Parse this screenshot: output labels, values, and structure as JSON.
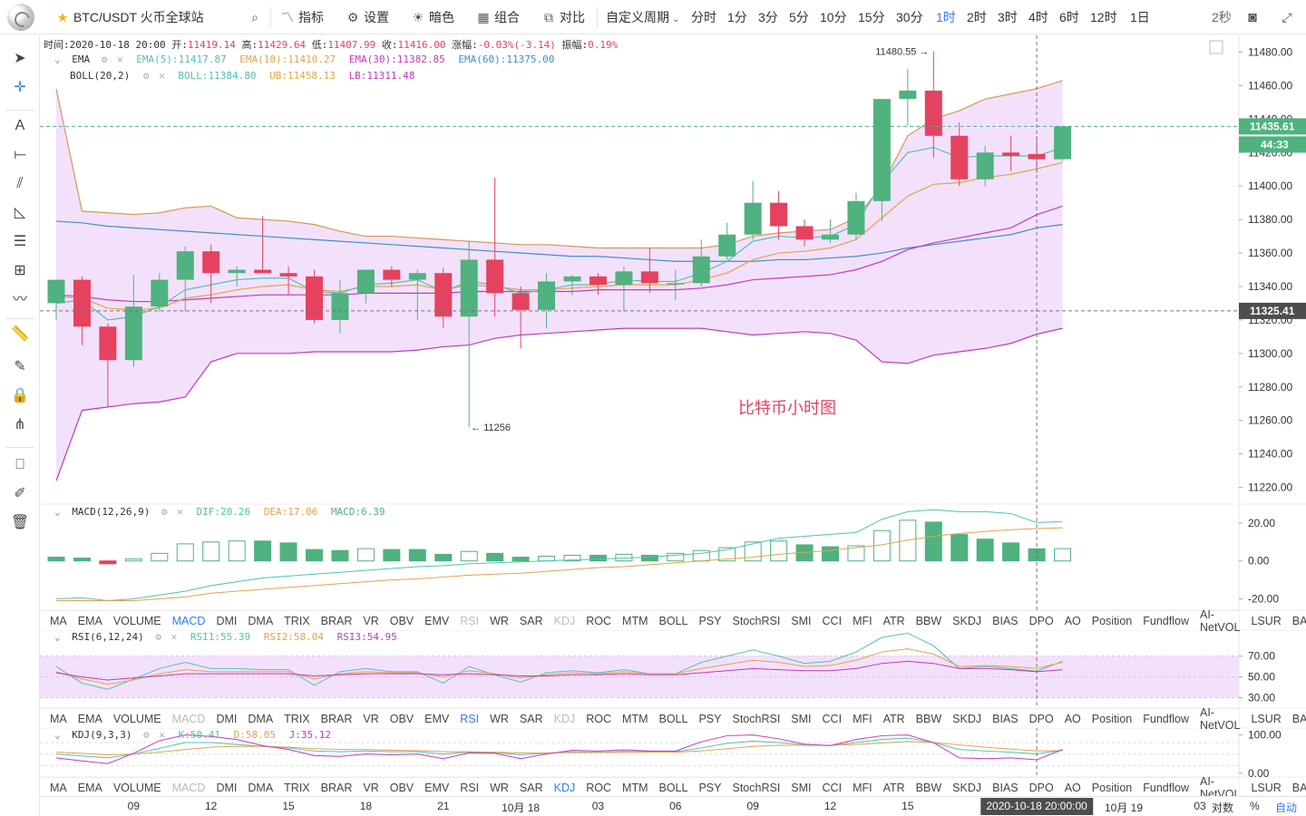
{
  "toolbar": {
    "symbol": "BTC/USDT 火币全球站",
    "indicators": "指标",
    "settings": "设置",
    "dark": "暗色",
    "combo": "组合",
    "compare": "对比",
    "custom_period": "自定义周期",
    "periods": [
      "分时",
      "1分",
      "3分",
      "5分",
      "10分",
      "15分",
      "30分",
      "1时",
      "2时",
      "3时",
      "4时",
      "6时",
      "12时",
      "1日"
    ],
    "active_period": "1时",
    "refresh": "2秒"
  },
  "ohlc_info": {
    "time_label": "时间:",
    "time": "2020-10-18 20:00",
    "open_label": "开:",
    "open": "11419.14",
    "high_label": "高:",
    "high": "11429.64",
    "low_label": "低:",
    "low": "11407.99",
    "close_label": "收:",
    "close": "11416.00",
    "change_label": "涨幅:",
    "change": "-0.03%(-3.14)",
    "amp_label": "振幅:",
    "amp": "0.19%"
  },
  "ema_legend": {
    "name": "EMA",
    "ema5": "EMA(5):11417.87",
    "ema10": "EMA(10):11410.27",
    "ema30": "EMA(30):11382.85",
    "ema60": "EMA(60):11375.00"
  },
  "boll_legend": {
    "name": "BOLL(20,2)",
    "boll": "BOLL:11384.80",
    "ub": "UB:11458.13",
    "lb": "LB:11311.48"
  },
  "macd_legend": {
    "name": "MACD(12,26,9)",
    "dif": "DIF:20.26",
    "dea": "DEA:17.06",
    "macd": "MACD:6.39"
  },
  "rsi_legend": {
    "name": "RSI(6,12,24)",
    "rsi1": "RSI1:55.39",
    "rsi2": "RSI2:58.04",
    "rsi3": "RSI3:54.95"
  },
  "kdj_legend": {
    "name": "KDJ(9,3,3)",
    "k": "K:50.41",
    "d": "D:58.05",
    "j": "J:35.12"
  },
  "indicator_tabs": [
    "MA",
    "EMA",
    "VOLUME",
    "MACD",
    "DMI",
    "DMA",
    "TRIX",
    "BRAR",
    "VR",
    "OBV",
    "EMV",
    "RSI",
    "WR",
    "SAR",
    "KDJ",
    "ROC",
    "MTM",
    "BOLL",
    "PSY",
    "StochRSI",
    "SMI",
    "CCI",
    "MFI",
    "ATR",
    "BBW",
    "SKDJ",
    "BIAS",
    "DPO",
    "AO",
    "Position",
    "Fundflow",
    "AI-NetVOL",
    "LSUR",
    "BASIS"
  ],
  "tab_rows": [
    {
      "on": "MACD",
      "dim": [
        "RSI",
        "KDJ"
      ]
    },
    {
      "on": "RSI",
      "dim": [
        "MACD",
        "KDJ"
      ]
    },
    {
      "on": "KDJ",
      "dim": [
        "MACD"
      ]
    }
  ],
  "chart_annotation": "比特币小时图",
  "price_labels": {
    "current": "11435.61",
    "countdown": "44:33",
    "cursor": "11325.41",
    "high_mark": "11480.55 →",
    "low_mark": "← 11256"
  },
  "x_axis": {
    "ticks": [
      {
        "label": "09",
        "i": 3
      },
      {
        "label": "12",
        "i": 6
      },
      {
        "label": "15",
        "i": 9
      },
      {
        "label": "18",
        "i": 12
      },
      {
        "label": "21",
        "i": 15
      },
      {
        "label": "10月 18",
        "i": 18
      },
      {
        "label": "03",
        "i": 21
      },
      {
        "label": "06",
        "i": 24
      },
      {
        "label": "09",
        "i": 27
      },
      {
        "label": "12",
        "i": 30
      },
      {
        "label": "15",
        "i": 33
      }
    ],
    "cursor_label": "2020-10-18 20:00:00",
    "next_label": "10月 19",
    "tail_label": "03",
    "log_label": "对数",
    "percent_label": "%",
    "auto_label": "自动"
  },
  "colors": {
    "up": "#4fb27f",
    "down": "#e5425f",
    "accent": "#2f7df6",
    "ema5": "#4fc1b5",
    "ema10": "#e0a44a",
    "ema30": "#c339c0",
    "ema60": "#3c90c9",
    "boll_ub": "#d29a55",
    "boll_lb": "#c339c0"
  },
  "chart_data": {
    "type": "candlestick",
    "price_axis": {
      "min": 11210,
      "max": 11490,
      "ticks": [
        11220,
        11240,
        11260,
        11280,
        11300,
        11320,
        11340,
        11360,
        11380,
        11400,
        11420,
        11440,
        11460,
        11480
      ]
    },
    "candles": [
      {
        "o": 11330,
        "h": 11342,
        "l": 11320,
        "c": 11344
      },
      {
        "o": 11344,
        "h": 11346,
        "l": 11305,
        "c": 11316
      },
      {
        "o": 11316,
        "h": 11318,
        "l": 11268,
        "c": 11296
      },
      {
        "o": 11296,
        "h": 11347,
        "l": 11292,
        "c": 11328
      },
      {
        "o": 11328,
        "h": 11348,
        "l": 11325,
        "c": 11344
      },
      {
        "o": 11344,
        "h": 11364,
        "l": 11325,
        "c": 11361
      },
      {
        "o": 11361,
        "h": 11365,
        "l": 11330,
        "c": 11348
      },
      {
        "o": 11348,
        "h": 11352,
        "l": 11340,
        "c": 11350
      },
      {
        "o": 11350,
        "h": 11382,
        "l": 11348,
        "c": 11348
      },
      {
        "o": 11348,
        "h": 11352,
        "l": 11335,
        "c": 11346
      },
      {
        "o": 11346,
        "h": 11350,
        "l": 11318,
        "c": 11320
      },
      {
        "o": 11320,
        "h": 11344,
        "l": 11312,
        "c": 11336
      },
      {
        "o": 11336,
        "h": 11350,
        "l": 11330,
        "c": 11350
      },
      {
        "o": 11350,
        "h": 11352,
        "l": 11340,
        "c": 11344
      },
      {
        "o": 11344,
        "h": 11350,
        "l": 11320,
        "c": 11348
      },
      {
        "o": 11348,
        "h": 11351,
        "l": 11315,
        "c": 11322
      },
      {
        "o": 11322,
        "h": 11367,
        "l": 11256,
        "c": 11356
      },
      {
        "o": 11356,
        "h": 11405,
        "l": 11322,
        "c": 11336
      },
      {
        "o": 11336,
        "h": 11340,
        "l": 11303,
        "c": 11326
      },
      {
        "o": 11326,
        "h": 11348,
        "l": 11315,
        "c": 11343
      },
      {
        "o": 11343,
        "h": 11347,
        "l": 11335,
        "c": 11346
      },
      {
        "o": 11346,
        "h": 11348,
        "l": 11335,
        "c": 11341
      },
      {
        "o": 11341,
        "h": 11352,
        "l": 11325,
        "c": 11349
      },
      {
        "o": 11349,
        "h": 11363,
        "l": 11336,
        "c": 11342
      },
      {
        "o": 11342,
        "h": 11350,
        "l": 11332,
        "c": 11342
      },
      {
        "o": 11342,
        "h": 11368,
        "l": 11340,
        "c": 11358
      },
      {
        "o": 11358,
        "h": 11378,
        "l": 11356,
        "c": 11371
      },
      {
        "o": 11371,
        "h": 11403,
        "l": 11368,
        "c": 11390
      },
      {
        "o": 11390,
        "h": 11397,
        "l": 11368,
        "c": 11376
      },
      {
        "o": 11376,
        "h": 11380,
        "l": 11364,
        "c": 11368
      },
      {
        "o": 11368,
        "h": 11380,
        "l": 11366,
        "c": 11371
      },
      {
        "o": 11371,
        "h": 11396,
        "l": 11368,
        "c": 11391
      },
      {
        "o": 11391,
        "h": 11401,
        "l": 11379,
        "c": 11452
      },
      {
        "o": 11452,
        "h": 11470,
        "l": 11436,
        "c": 11457
      },
      {
        "o": 11457,
        "h": 11480.55,
        "l": 11417,
        "c": 11430
      },
      {
        "o": 11430,
        "h": 11438,
        "l": 11400,
        "c": 11404
      },
      {
        "o": 11404,
        "h": 11424,
        "l": 11400,
        "c": 11420
      },
      {
        "o": 11420,
        "h": 11430,
        "l": 11409,
        "c": 11418
      },
      {
        "o": 11419.14,
        "h": 11429.64,
        "l": 11407.99,
        "c": 11416.0
      },
      {
        "o": 11416,
        "h": 11436,
        "l": 11415,
        "c": 11435.61
      }
    ],
    "ema5": [
      11330,
      11332,
      11320,
      11322,
      11328,
      11338,
      11341,
      11344,
      11345,
      11345,
      11337,
      11336,
      11341,
      11342,
      11344,
      11337,
      11343,
      11341,
      11336,
      11338,
      11341,
      11341,
      11344,
      11343,
      11343,
      11348,
      11355,
      11367,
      11370,
      11369,
      11370,
      11377,
      11402,
      11420,
      11423,
      11417,
      11418,
      11418,
      11417.87,
      11423
    ],
    "ema10": [
      11334,
      11333,
      11327,
      11326,
      11327,
      11333,
      11335,
      11338,
      11340,
      11341,
      11338,
      11337,
      11340,
      11340,
      11341,
      11338,
      11341,
      11340,
      11338,
      11338,
      11339,
      11340,
      11341,
      11341,
      11341,
      11344,
      11348,
      11356,
      11360,
      11361,
      11363,
      11368,
      11381,
      11394,
      11401,
      11402,
      11405,
      11407,
      11410.27,
      11414
    ],
    "ema30": [
      11335,
      11334,
      11332,
      11331,
      11331,
      11332,
      11333,
      11334,
      11335,
      11335,
      11335,
      11335,
      11336,
      11336,
      11336,
      11336,
      11337,
      11337,
      11337,
      11337,
      11337,
      11338,
      11338,
      11338,
      11338,
      11339,
      11341,
      11344,
      11345,
      11346,
      11347,
      11350,
      11355,
      11362,
      11366,
      11369,
      11372,
      11375,
      11382.85,
      11388
    ],
    "ema60": [
      11379,
      11378,
      11376,
      11375,
      11374,
      11373,
      11372,
      11371,
      11370,
      11369,
      11368,
      11367,
      11366,
      11365,
      11364,
      11363,
      11362,
      11361,
      11360,
      11359,
      11358,
      11358,
      11357,
      11356,
      11355,
      11355,
      11355,
      11355,
      11356,
      11356,
      11357,
      11358,
      11360,
      11363,
      11365,
      11367,
      11369,
      11371,
      11375.0,
      11377
    ],
    "boll_ub": [
      11458,
      11385,
      11384,
      11383,
      11384,
      11387,
      11388,
      11381,
      11380,
      11379,
      11377,
      11373,
      11370,
      11370,
      11369,
      11368,
      11367,
      11366,
      11365,
      11365,
      11364,
      11363,
      11363,
      11363,
      11363,
      11363,
      11365,
      11370,
      11372,
      11373,
      11374,
      11381,
      11400,
      11430,
      11440,
      11445,
      11452,
      11455,
      11458.13,
      11463
    ],
    "boll_mid": [
      11348,
      11346,
      11338,
      11336,
      11337,
      11340,
      11342,
      11340,
      11341,
      11341,
      11340,
      11340,
      11340,
      11340,
      11340,
      11339,
      11339,
      11339,
      11339,
      11339,
      11339,
      11340,
      11340,
      11340,
      11340,
      11340,
      11342,
      11346,
      11348,
      11350,
      11351,
      11354,
      11360,
      11370,
      11377,
      11379,
      11381,
      11383,
      11384.8,
      11387
    ],
    "boll_lb": [
      11224,
      11266,
      11268,
      11270,
      11271,
      11274,
      11295,
      11300,
      11300,
      11300,
      11301,
      11301,
      11301,
      11301,
      11302,
      11304,
      11305,
      11309,
      11311,
      11312,
      11313,
      11314,
      11315,
      11315,
      11315,
      11315,
      11313,
      11311,
      11312,
      11313,
      11312,
      11308,
      11295,
      11294,
      11299,
      11301,
      11303,
      11306,
      11311.48,
      11315
    ],
    "macd_axis": {
      "ticks": [
        20,
        0,
        -20
      ]
    },
    "macd_hist": [
      2,
      1.5,
      -1.5,
      1,
      4,
      9,
      10,
      10.5,
      10.5,
      9.5,
      6,
      5.5,
      6.5,
      6,
      6,
      3.5,
      5,
      4,
      2,
      2.5,
      3,
      3,
      3.5,
      3,
      4,
      5.5,
      7,
      10,
      10.5,
      8.5,
      7.5,
      8,
      16,
      21.5,
      20.5,
      14,
      11.5,
      9.5,
      6.39,
      6.5
    ],
    "macd_dif": [
      -20,
      -19.5,
      -21,
      -20,
      -18,
      -16,
      -13,
      -11,
      -9,
      -8,
      -7,
      -6,
      -5,
      -4,
      -3,
      -2.5,
      -1.5,
      -1,
      -0.5,
      0,
      0.5,
      1,
      1.5,
      2,
      3,
      4,
      6,
      9,
      12,
      13,
      14,
      15,
      22,
      26,
      27,
      26,
      26,
      25,
      20.26,
      20.8
    ],
    "macd_dea": [
      -21,
      -21,
      -21,
      -21,
      -20,
      -19,
      -17,
      -16,
      -15,
      -14,
      -13,
      -12,
      -11,
      -10,
      -9.5,
      -8.5,
      -7.5,
      -7,
      -6.5,
      -5.5,
      -4.5,
      -3.5,
      -3,
      -2,
      -1,
      0,
      1,
      2,
      3.5,
      4.5,
      5.5,
      7,
      8.5,
      11,
      13,
      14.5,
      15.5,
      16.5,
      17.06,
      17.5
    ],
    "rsi_axis": {
      "ticks": [
        70,
        50,
        30
      ]
    },
    "rsi1": [
      60,
      44,
      38,
      48,
      58,
      64,
      58,
      58,
      57,
      57,
      42,
      55,
      58,
      55,
      55,
      44,
      60,
      52,
      45,
      54,
      56,
      54,
      57,
      53,
      53,
      64,
      70,
      76,
      70,
      63,
      65,
      74,
      88,
      92,
      80,
      58,
      60,
      58,
      55.39,
      65
    ],
    "rsi2": [
      55,
      48,
      43,
      47,
      53,
      57,
      55,
      55,
      55,
      55,
      48,
      53,
      55,
      54,
      54,
      50,
      56,
      53,
      49,
      52,
      54,
      53,
      55,
      53,
      53,
      58,
      62,
      66,
      64,
      60,
      61,
      66,
      74,
      77,
      72,
      60,
      61,
      60,
      58.04,
      64
    ],
    "rsi3": [
      54,
      50,
      47,
      49,
      51,
      53,
      53,
      53,
      53,
      53,
      51,
      52,
      53,
      53,
      53,
      52,
      53,
      52,
      51,
      51,
      52,
      52,
      53,
      52,
      52,
      54,
      56,
      58,
      57,
      56,
      56,
      58,
      63,
      65,
      63,
      58,
      58,
      57,
      54.95,
      57
    ],
    "kdj_axis": {
      "ticks": [
        100,
        0
      ]
    },
    "kdj_k": [
      50,
      45,
      40,
      50,
      65,
      80,
      80,
      75,
      70,
      66,
      58,
      56,
      58,
      56,
      56,
      50,
      55,
      54,
      48,
      52,
      56,
      55,
      57,
      56,
      56,
      66,
      78,
      84,
      80,
      74,
      72,
      80,
      88,
      92,
      80,
      62,
      58,
      55,
      50.41,
      60
    ],
    "kdj_d": [
      55,
      52,
      48,
      50,
      55,
      62,
      68,
      70,
      70,
      68,
      64,
      62,
      62,
      60,
      59,
      56,
      56,
      55,
      53,
      53,
      54,
      54,
      55,
      55,
      55,
      58,
      64,
      70,
      73,
      73,
      73,
      75,
      79,
      83,
      80,
      74,
      68,
      63,
      58.05,
      59
    ],
    "kdj_j": [
      40,
      32,
      25,
      52,
      85,
      100,
      96,
      88,
      72,
      62,
      46,
      44,
      50,
      48,
      50,
      38,
      53,
      52,
      38,
      50,
      60,
      58,
      61,
      58,
      58,
      82,
      98,
      100,
      90,
      76,
      72,
      88,
      98,
      100,
      80,
      40,
      38,
      40,
      35.12,
      62
    ]
  }
}
